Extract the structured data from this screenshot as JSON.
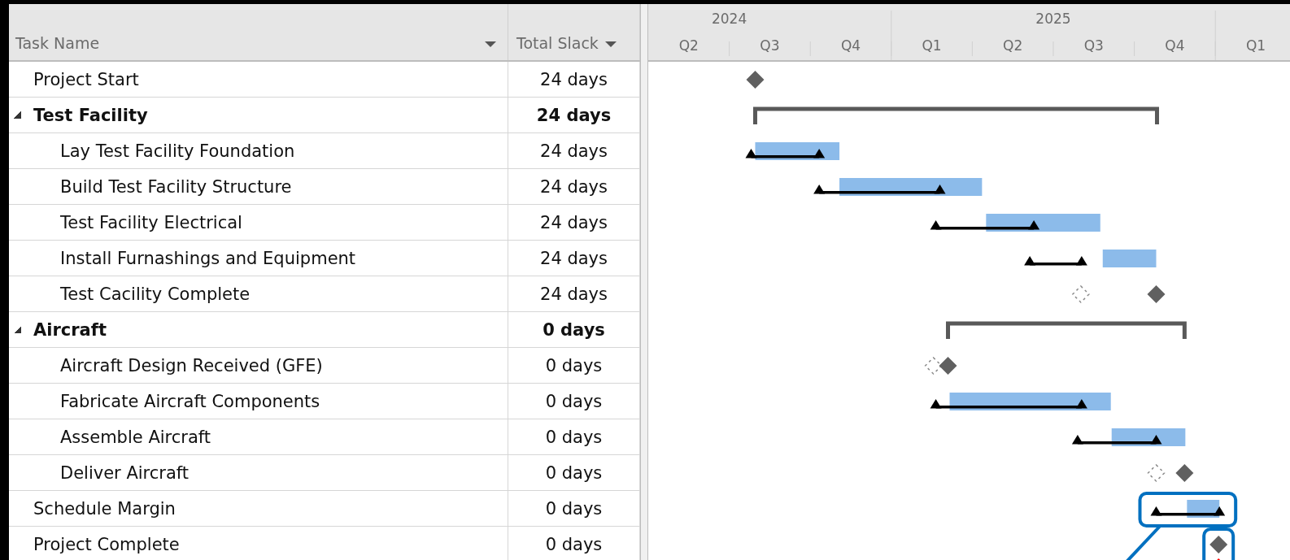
{
  "columns": [
    {
      "label": "Task Name"
    },
    {
      "label": "Total Slack"
    }
  ],
  "timeline": {
    "years": [
      "2024",
      "2025"
    ],
    "quarters": [
      "Q2",
      "Q3",
      "Q4",
      "Q1",
      "Q2",
      "Q3",
      "Q4",
      "Q1"
    ]
  },
  "tasks": [
    {
      "name": "Project Start",
      "slack": "24 days",
      "kind": "milestone"
    },
    {
      "name": "Test Facility",
      "slack": "24 days",
      "kind": "summary",
      "expanded": true,
      "children": [
        {
          "name": "Lay Test Facility Foundation",
          "slack": "24 days",
          "kind": "task",
          "baseline": true
        },
        {
          "name": "Build Test Facility Structure",
          "slack": "24 days",
          "kind": "task",
          "baseline": true
        },
        {
          "name": "Test Facility Electrical",
          "slack": "24 days",
          "kind": "task",
          "baseline": true
        },
        {
          "name": "Install Furnashings and Equipment",
          "slack": "24 days",
          "kind": "task",
          "baseline": true
        },
        {
          "name": "Test Cacility Complete",
          "slack": "24 days",
          "kind": "milestone",
          "baseline": true
        }
      ]
    },
    {
      "name": "Aircraft",
      "slack": "0 days",
      "kind": "summary",
      "expanded": true,
      "children": [
        {
          "name": "Aircraft Design Received (GFE)",
          "slack": "0 days",
          "kind": "milestone",
          "baseline": true
        },
        {
          "name": "Fabricate Aircraft Components",
          "slack": "0 days",
          "kind": "task",
          "baseline": true
        },
        {
          "name": "Assemble Aircraft",
          "slack": "0 days",
          "kind": "task",
          "baseline": true
        },
        {
          "name": "Deliver Aircraft",
          "slack": "0 days",
          "kind": "milestone",
          "baseline": true
        }
      ]
    },
    {
      "name": "Schedule Margin",
      "slack": "0 days",
      "kind": "task",
      "baseline": true,
      "highlighted": true,
      "leader_line": true
    },
    {
      "name": "Project Complete",
      "slack": "0 days",
      "kind": "milestone",
      "deadline": true,
      "highlighted": true
    }
  ]
}
